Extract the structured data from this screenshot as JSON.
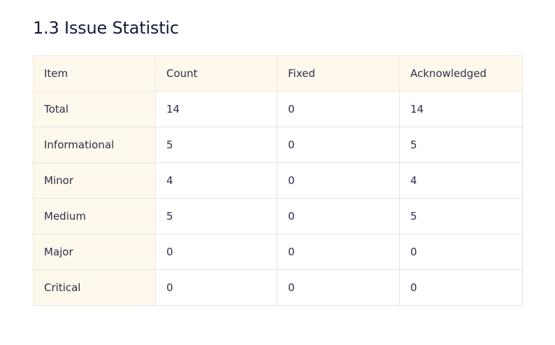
{
  "section": {
    "title": "1.3 Issue Statistic"
  },
  "table": {
    "headers": [
      "Item",
      "Count",
      "Fixed",
      "Acknowledged"
    ],
    "rows": [
      [
        "Total",
        "14",
        "0",
        "14"
      ],
      [
        "Informational",
        "5",
        "0",
        "5"
      ],
      [
        "Minor",
        "4",
        "0",
        "4"
      ],
      [
        "Medium",
        "5",
        "0",
        "5"
      ],
      [
        "Major",
        "0",
        "0",
        "0"
      ],
      [
        "Critical",
        "0",
        "0",
        "0"
      ]
    ]
  },
  "colors": {
    "header_bg": "#fff8ec",
    "border": "#e3e3e6",
    "text": "#2b2f4a"
  }
}
